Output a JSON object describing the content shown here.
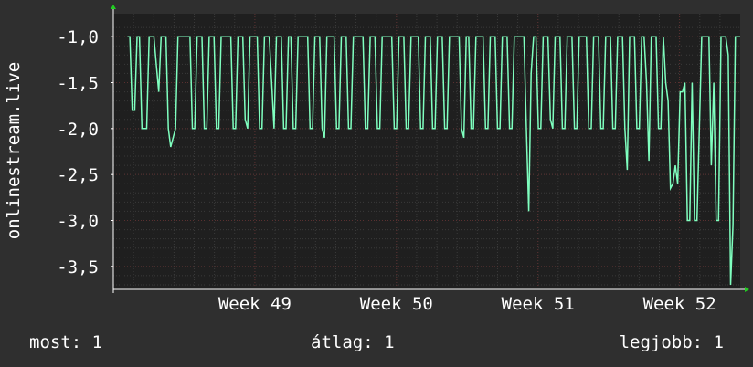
{
  "chart_data": {
    "type": "line",
    "ylabel": "onlinestream.live",
    "title": "",
    "xlabel": "",
    "y_ticks": [
      "-1,0",
      "-1,5",
      "-2,0",
      "-2,5",
      "-3,0",
      "-3,5"
    ],
    "y_tick_values": [
      -1.0,
      -1.5,
      -2.0,
      -2.5,
      -3.0,
      -3.5
    ],
    "ylim": [
      -3.75,
      -0.75
    ],
    "x_ticks": [
      "Week 49",
      "Week 50",
      "Week 51",
      "Week 52"
    ],
    "x_tick_positions_days": [
      7,
      14,
      21,
      28
    ],
    "xlim_days": [
      0,
      31
    ],
    "grid": true,
    "colors": {
      "background": "#2f2f2f",
      "plot": "#1f1f1f",
      "line": "#7fffbf",
      "grid_major": "#5a3030",
      "grid_minor": "#3a3a3a",
      "axis": "#ffffff"
    },
    "series": [
      {
        "values": [
          -1,
          -1,
          -1.8,
          -1.8,
          -1,
          -1,
          -2,
          -2,
          -2,
          -1,
          -1,
          -1,
          -1.3,
          -1.6,
          -1,
          -1,
          -1,
          -2,
          -2.2,
          -2.1,
          -2,
          -1,
          -1,
          -1,
          -1,
          -1,
          -1,
          -2,
          -2,
          -1,
          -1,
          -1,
          -2,
          -2,
          -1,
          -1,
          -1,
          -2,
          -2,
          -1,
          -1,
          -1,
          -1,
          -1,
          -2,
          -2,
          -1,
          -1,
          -1,
          -1.9,
          -2,
          -1,
          -1,
          -1,
          -1,
          -2,
          -2,
          -1,
          -1,
          -1,
          -1.5,
          -2,
          -1,
          -1,
          -1,
          -2,
          -2,
          -1,
          -1,
          -2,
          -2,
          -1,
          -1,
          -1,
          -1,
          -1,
          -2,
          -2,
          -1,
          -1,
          -1,
          -2,
          -2.1,
          -1,
          -1,
          -1,
          -1,
          -2,
          -2,
          -1,
          -1,
          -1,
          -2,
          -2,
          -1,
          -1,
          -1,
          -1,
          -1,
          -2,
          -2,
          -1,
          -1,
          -1,
          -2,
          -2,
          -1,
          -1,
          -1,
          -1,
          -1,
          -2,
          -2,
          -1,
          -1,
          -1,
          -2,
          -2,
          -1,
          -1,
          -1,
          -1,
          -2,
          -2,
          -1,
          -1,
          -1,
          -2,
          -2,
          -1,
          -1,
          -1,
          -2,
          -2,
          -1,
          -1,
          -1,
          -1,
          -1,
          -2,
          -2.1,
          -1,
          -1,
          -2,
          -2,
          -1,
          -1,
          -1,
          -1,
          -2,
          -2,
          -1,
          -1,
          -1,
          -2,
          -2,
          -1,
          -1,
          -1,
          -2,
          -2,
          -1,
          -1,
          -1,
          -1,
          -1,
          -2,
          -2.9,
          -1.4,
          -1,
          -1,
          -2,
          -2,
          -1,
          -1,
          -1,
          -1.9,
          -2,
          -1,
          -1,
          -1,
          -2,
          -2,
          -1,
          -1,
          -1,
          -2,
          -2,
          -1,
          -1,
          -1,
          -1,
          -2,
          -2,
          -1,
          -1,
          -1,
          -2,
          -2,
          -1,
          -1,
          -1,
          -2,
          -2,
          -1,
          -1,
          -1,
          -2,
          -2.45,
          -1,
          -1,
          -1,
          -2,
          -2,
          -1,
          -1,
          -1.5,
          -2.35,
          -1,
          -1,
          -1,
          -2,
          -2,
          -1,
          -1.5,
          -1.7,
          -2.65,
          -2.6,
          -2.4,
          -2.6,
          -1.6,
          -1.6,
          -1.5,
          -3,
          -3,
          -1.5,
          -3,
          -3,
          -2,
          -1,
          -1,
          -1,
          -1,
          -2.4,
          -1.5,
          -3,
          -3,
          -1,
          -1,
          -1,
          -1.2,
          -3.7,
          -3.05,
          -1,
          -1,
          -1
        ],
        "x_start_days": 0.7,
        "x_end_days": 31
      }
    ]
  },
  "stats": {
    "now": "most: 1",
    "avg": "átlag: 1",
    "best": "legjobb: 1"
  }
}
